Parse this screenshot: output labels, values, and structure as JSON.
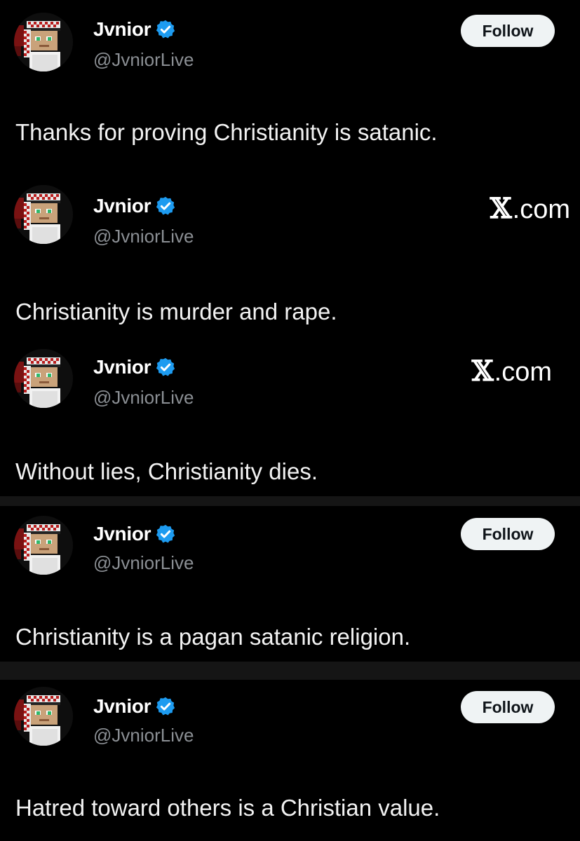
{
  "posts": [
    {
      "author": {
        "display_name": "Jvnior",
        "handle": "@JvniorLive",
        "verified": true
      },
      "corner_action": {
        "kind": "follow-button",
        "label": "Follow"
      },
      "text": "Thanks for proving Christianity is satanic."
    },
    {
      "author": {
        "display_name": "Jvnior",
        "handle": "@JvniorLive",
        "verified": true
      },
      "corner_action": {
        "kind": "site-watermark",
        "mark": "𝕏",
        "label": ".com"
      },
      "text": "Christianity is murder and rape."
    },
    {
      "author": {
        "display_name": "Jvnior",
        "handle": "@JvniorLive",
        "verified": true
      },
      "corner_action": {
        "kind": "site-watermark",
        "mark": "𝕏",
        "label": ".com"
      },
      "text": "Without lies, Christianity dies."
    },
    {
      "author": {
        "display_name": "Jvnior",
        "handle": "@JvniorLive",
        "verified": true
      },
      "corner_action": {
        "kind": "follow-button",
        "label": "Follow"
      },
      "text": "Christianity is a pagan satanic religion."
    },
    {
      "author": {
        "display_name": "Jvnior",
        "handle": "@JvniorLive",
        "verified": true
      },
      "corner_action": {
        "kind": "follow-button",
        "label": "Follow"
      },
      "text": "Hatred toward others is a Christian value."
    }
  ],
  "colors": {
    "background": "#000000",
    "verified_badge": "#1d9bf0",
    "handle_text": "#8b8f94",
    "follow_button_bg": "#eff3f4",
    "follow_button_text": "#0f1419",
    "separator": "#151515"
  },
  "icons": {
    "verified": "verified-badge-icon",
    "avatar": "pixel-art-avatar"
  }
}
